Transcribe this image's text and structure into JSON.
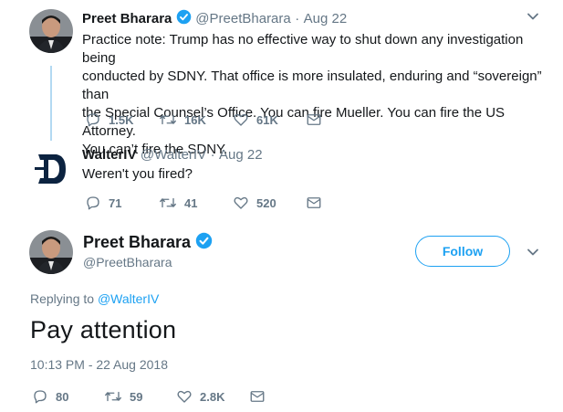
{
  "tweet1": {
    "name": "Preet Bharara",
    "handle": "@PreetBharara",
    "dot": "·",
    "date": "Aug 22",
    "text_lines": [
      "Practice note: Trump has no effective way to shut down any investigation being",
      "conducted by SDNY. That office is more insulated, enduring and “sovereign” than",
      "the Special Counsel’s Office. You can fire Mueller. You can fire the US Attorney.",
      "You can’t fire the SDNY."
    ],
    "replies": "1.5K",
    "retweets": "16K",
    "likes": "61K"
  },
  "tweet2": {
    "name": "WalterIV",
    "handle": "@WalterIV",
    "dot": "·",
    "date": "Aug 22",
    "text": "Weren't you fired?",
    "replies": "71",
    "retweets": "41",
    "likes": "520"
  },
  "main": {
    "name": "Preet Bharara",
    "handle": "@PreetBharara",
    "follow_label": "Follow",
    "replying_prefix": "Replying to ",
    "replying_to": "@WalterIV",
    "text": "Pay attention",
    "timestamp": "10:13 PM - 22 Aug 2018",
    "replies": "80",
    "retweets": "59",
    "likes": "2.8K"
  },
  "colors": {
    "accent": "#1da1f2",
    "muted": "#657786",
    "thread_line": "#b3d9f2",
    "tigers_navy": "#0c2340"
  },
  "icons": [
    "reply-icon",
    "retweet-icon",
    "like-icon",
    "message-icon",
    "chevron-down-icon",
    "verified-badge-icon",
    "tigers-logo-avatar"
  ]
}
